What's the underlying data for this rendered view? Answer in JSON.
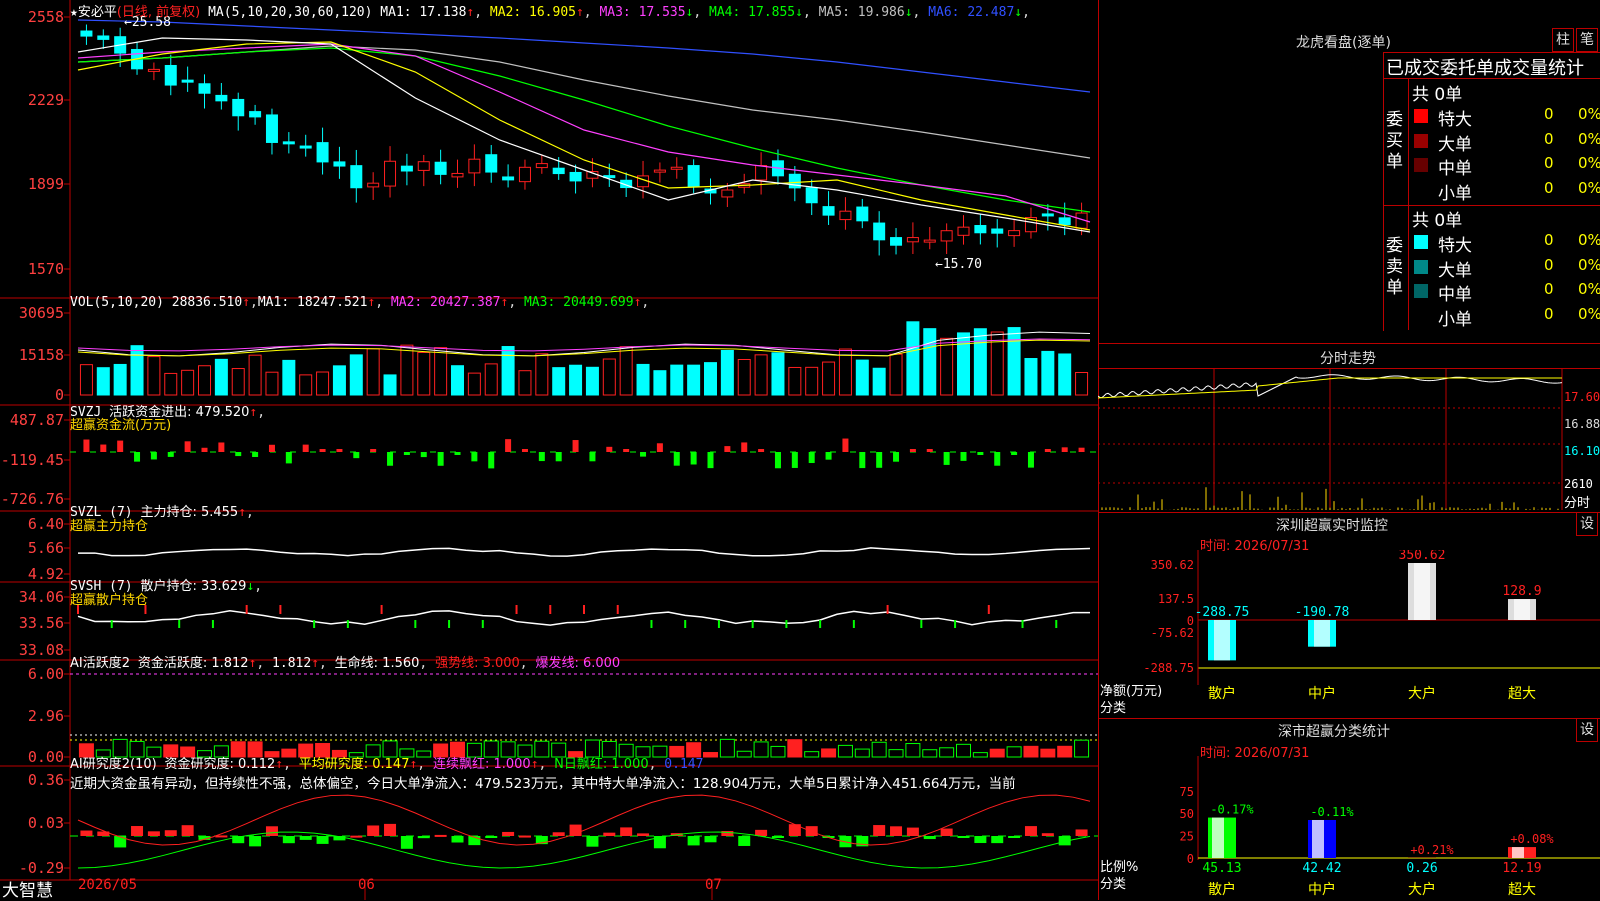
{
  "stock": {
    "star": "★",
    "name": "安必平",
    "mode": "(日线, 前复权)",
    "ma_def": "MA(5,10,20,30,60,120)",
    "ma": [
      {
        "label": "MA1: 17.138",
        "arrow": "↑",
        "color": "#ffffff"
      },
      {
        "label": "MA2: 16.905",
        "arrow": "↑",
        "color": "#ffff00"
      },
      {
        "label": "MA3: 17.535",
        "arrow": "↓",
        "color": "#ff40ff"
      },
      {
        "label": "MA4: 17.855",
        "arrow": "↓",
        "color": "#00ff00"
      },
      {
        "label": "MA5: 19.986",
        "arrow": "↓",
        "color": "#c0c0c0"
      },
      {
        "label": "MA6: 22.487",
        "arrow": "↓",
        "color": "#3050ff"
      }
    ],
    "price_axis": [
      "2558",
      "2229",
      "1899",
      "1570"
    ],
    "high_mark": "25.58",
    "low_mark": "15.70"
  },
  "vol": {
    "def": "VOL(5,10,20)",
    "value": "28836.510",
    "arrow": "↑",
    "ma": [
      {
        "label": "MA1: 18247.521",
        "arrow": "↑",
        "color": "#ffffff"
      },
      {
        "label": "MA2: 20427.387",
        "arrow": "↑",
        "color": "#ff40ff"
      },
      {
        "label": "MA3: 20449.699",
        "arrow": "↑",
        "color": "#00ff00"
      }
    ],
    "axis": [
      "30695",
      "15158",
      "0"
    ]
  },
  "svzj": {
    "def": "SVZJ",
    "label": "活跃资金进出: 479.520",
    "arrow": "↑",
    "sub": "超赢资金流(万元)",
    "axis": [
      "487.87",
      "-119.45",
      "-726.76"
    ]
  },
  "svzl": {
    "def": "SVZL (7)",
    "label": "主力持仓: 5.455",
    "arrow": "↑",
    "tail": ",",
    "sub": "超赢主力持仓",
    "axis": [
      "6.40",
      "5.66",
      "4.92"
    ]
  },
  "svsh": {
    "def": "SVSH (7)",
    "label": "散户持仓: 33.629",
    "arrow": "↓",
    "tail": ",",
    "sub": "超赢散户持仓",
    "axis": [
      "34.06",
      "33.56",
      "33.08"
    ]
  },
  "ai1": {
    "def": "AI活跃度2",
    "a": "资金活跃度: 1.812",
    "b": "1.812",
    "c": "生命线: 1.560",
    "d": "强势线: 3.000",
    "e": "爆发线: 6.000",
    "axis": [
      "6.00",
      "2.96",
      "0.00"
    ]
  },
  "ai2": {
    "def": "AI研究度2(10)",
    "a": "资金研究度: 0.112",
    "b": "平均研究度: 0.147",
    "c": "连续飘红: 1.000",
    "d": "N日飘红: 1.000",
    "e": "0.147",
    "text": "近期大资金虽有异动，但持续性不强，总体偏空，今日大单净流入：479.523万元，其中特大单净流入：128.904万元，大单5日累计净入451.664万元，当前",
    "axis": [
      "0.36",
      "0.03",
      "-0.29"
    ]
  },
  "bottom": {
    "brand": "大智慧",
    "dates": [
      "2026/05",
      "06",
      "07"
    ]
  },
  "lhb": {
    "title": "龙虎看盘(逐单)",
    "btn1": "柱",
    "btn2": "笔",
    "header": "已成交委托单成交量统计",
    "buy": {
      "side": "委买单",
      "total": "共 0单",
      "rows": [
        {
          "label": "特大",
          "v": "0",
          "p": "0%",
          "color": "#ff0000"
        },
        {
          "label": "大单",
          "v": "0",
          "p": "0%",
          "color": "#990000"
        },
        {
          "label": "中单",
          "v": "0",
          "p": "0%",
          "color": "#660000"
        },
        {
          "label": "小单",
          "v": "0",
          "p": "0%",
          "color": "#000000"
        }
      ]
    },
    "sell": {
      "side": "委卖单",
      "total": "共 0单",
      "rows": [
        {
          "label": "特大",
          "v": "0",
          "p": "0%",
          "color": "#00ffff"
        },
        {
          "label": "大单",
          "v": "0",
          "p": "0%",
          "color": "#008888"
        },
        {
          "label": "中单",
          "v": "0",
          "p": "0%",
          "color": "#006666"
        },
        {
          "label": "小单",
          "v": "0",
          "p": "0%",
          "color": "#000000"
        }
      ]
    }
  },
  "intraday": {
    "title": "分时走势",
    "axis": [
      "17.60",
      "16.88",
      "16.10"
    ],
    "vol_axis": "2610",
    "vol_unit": "分时"
  },
  "monitor": {
    "title": "深圳超赢实时监控",
    "btn": "设",
    "time": "时间: 2026/07/31",
    "ylabel": "净额(万元)",
    "xcat": "分类",
    "axis": [
      "350.62",
      "137.5",
      "0",
      "-75.62",
      "-288.75"
    ]
  },
  "classify": {
    "title": "深市超赢分类统计",
    "btn": "设",
    "time": "时间: 2026/07/31",
    "ylabel": "比例%",
    "xcat": "分类",
    "axis": [
      "75",
      "50",
      "25",
      "0"
    ]
  },
  "chart_data": [
    {
      "type": "candlestick",
      "series": [
        {
          "name": "MA1",
          "value": 17.138
        },
        {
          "name": "MA2",
          "value": 16.905
        },
        {
          "name": "MA3",
          "value": 17.535
        },
        {
          "name": "MA4",
          "value": 17.855
        },
        {
          "name": "MA5",
          "value": 19.986
        },
        {
          "name": "MA6",
          "value": 22.487
        }
      ],
      "x": [
        "2026/05",
        "06",
        "07"
      ],
      "y_ticks": [
        25.58,
        22.29,
        18.99,
        15.7
      ]
    },
    {
      "type": "bar",
      "title": "深圳超赢实时监控",
      "categories": [
        "散户",
        "中户",
        "大户",
        "超大"
      ],
      "values": [
        -288.75,
        -190.78,
        350.62,
        128.9
      ],
      "ylim": [
        -288.75,
        350.62
      ]
    },
    {
      "type": "bar",
      "title": "深市超赢分类统计",
      "categories": [
        "散户",
        "中户",
        "大户",
        "超大"
      ],
      "values": [
        45.13,
        42.42,
        0.26,
        12.19
      ],
      "changes": [
        "-0.17%",
        "-0.11%",
        "+0.21%",
        "+0.08%"
      ],
      "ylim": [
        0,
        75
      ]
    }
  ]
}
